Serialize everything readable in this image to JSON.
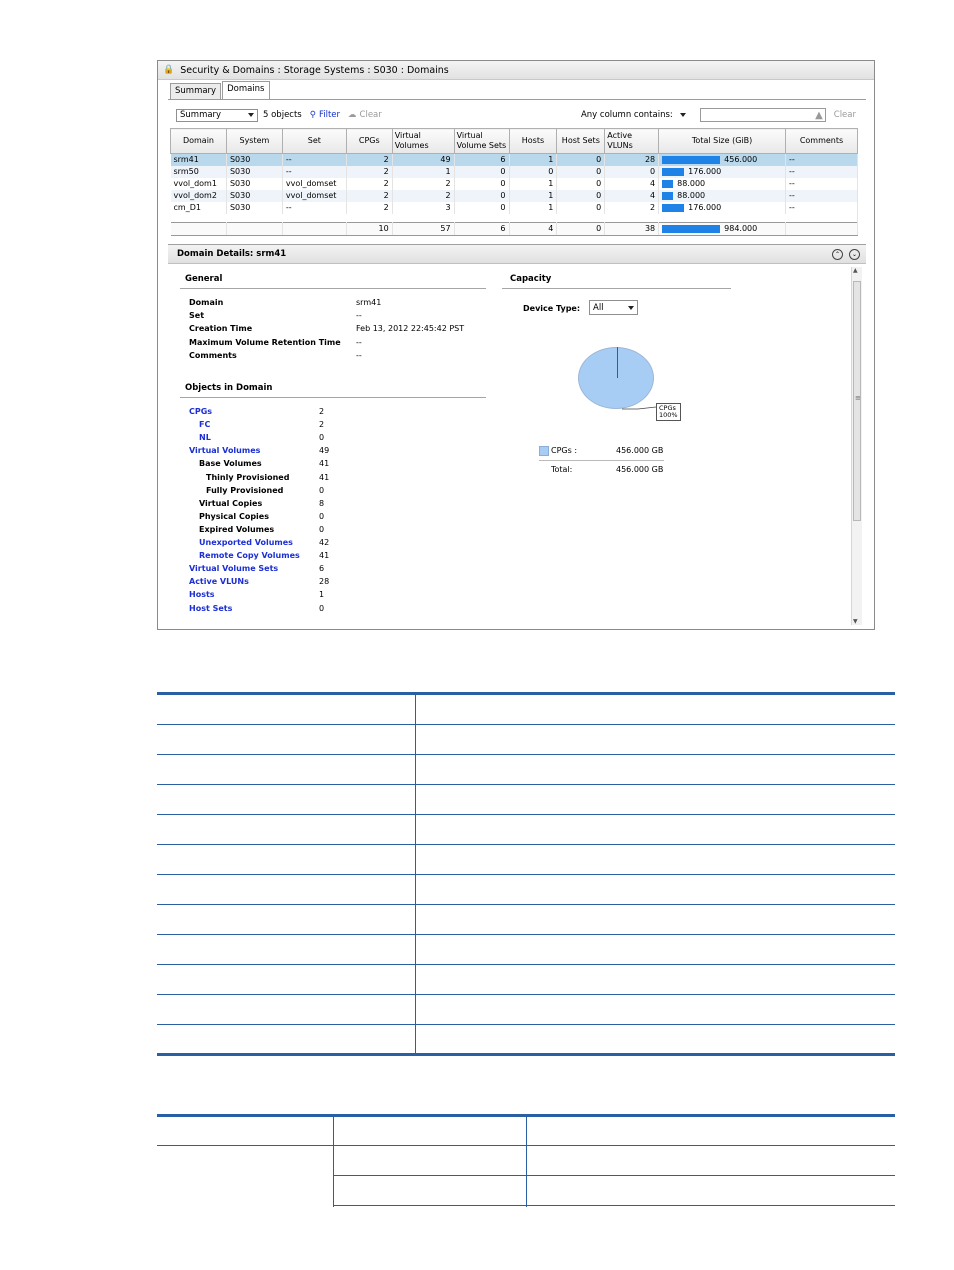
{
  "window": {
    "title": "Security & Domains : Storage Systems : S030 : Domains",
    "tabs": [
      "Summary",
      "Domains"
    ]
  },
  "toolbar": {
    "view_select": "Summary",
    "object_count": "5 objects",
    "filter_label": "Filter",
    "clear_label": "Clear",
    "search_label": "Any column contains:",
    "search_value": "",
    "search_clear": "Clear"
  },
  "grid": {
    "columns": [
      "Domain",
      "System",
      "Set",
      "CPGs",
      "Virtual Volumes",
      "Virtual Volume Sets",
      "Hosts",
      "Host Sets",
      "Active VLUNs",
      "Total Size (GiB)",
      "Comments"
    ],
    "rows": [
      {
        "domain": "srm41",
        "system": "S030",
        "set": "--",
        "cpgs": "2",
        "vv": "49",
        "vvsets": "6",
        "hosts": "1",
        "hostsets": "0",
        "vluns": "28",
        "size": "456.000",
        "size_frac": 1.0,
        "comments": "--"
      },
      {
        "domain": "srm50",
        "system": "S030",
        "set": "--",
        "cpgs": "2",
        "vv": "1",
        "vvsets": "0",
        "hosts": "0",
        "hostsets": "0",
        "vluns": "0",
        "size": "176.000",
        "size_frac": 0.386,
        "comments": "--"
      },
      {
        "domain": "vvol_dom1",
        "system": "S030",
        "set": "vvol_domset",
        "cpgs": "2",
        "vv": "2",
        "vvsets": "0",
        "hosts": "1",
        "hostsets": "0",
        "vluns": "4",
        "size": "88.000",
        "size_frac": 0.193,
        "comments": "--"
      },
      {
        "domain": "vvol_dom2",
        "system": "S030",
        "set": "vvol_domset",
        "cpgs": "2",
        "vv": "2",
        "vvsets": "0",
        "hosts": "1",
        "hostsets": "0",
        "vluns": "4",
        "size": "88.000",
        "size_frac": 0.193,
        "comments": "--"
      },
      {
        "domain": "cm_D1",
        "system": "S030",
        "set": "--",
        "cpgs": "2",
        "vv": "3",
        "vvsets": "0",
        "hosts": "1",
        "hostsets": "0",
        "vluns": "2",
        "size": "176.000",
        "size_frac": 0.386,
        "comments": "--"
      }
    ],
    "totals": {
      "cpgs": "10",
      "vv": "57",
      "vvsets": "6",
      "hosts": "4",
      "hostsets": "0",
      "vluns": "38",
      "size": "984.000",
      "size_frac": 1.0
    }
  },
  "details": {
    "title": "Domain Details: srm41",
    "general_title": "General",
    "general": [
      {
        "label": "Domain",
        "value": "srm41"
      },
      {
        "label": "Set",
        "value": "--"
      },
      {
        "label": "Creation Time",
        "value": "Feb 13, 2012 22:45:42 PST"
      },
      {
        "label": "Maximum Volume Retention Time",
        "value": "--"
      },
      {
        "label": "Comments",
        "value": "--"
      }
    ],
    "objects_title": "Objects in Domain",
    "objects": [
      {
        "label": "CPGs",
        "value": "2"
      },
      {
        "label": "FC",
        "value": "2"
      },
      {
        "label": "NL",
        "value": "0"
      },
      {
        "label": "Virtual Volumes",
        "value": "49"
      },
      {
        "label": "Base Volumes",
        "value": "41"
      },
      {
        "label": "Thinly Provisioned",
        "value": "41"
      },
      {
        "label": "Fully Provisioned",
        "value": "0"
      },
      {
        "label": "Virtual Copies",
        "value": "8"
      },
      {
        "label": "Physical Copies",
        "value": "0"
      },
      {
        "label": "Expired Volumes",
        "value": "0"
      },
      {
        "label": "Unexported Volumes",
        "value": "42"
      },
      {
        "label": "Remote Copy Volumes",
        "value": "41"
      },
      {
        "label": "Virtual Volume Sets",
        "value": "6"
      },
      {
        "label": "Active VLUNs",
        "value": "28"
      },
      {
        "label": "Hosts",
        "value": "1"
      },
      {
        "label": "Host Sets",
        "value": "0"
      }
    ],
    "capacity_title": "Capacity",
    "device_type_label": "Device Type:",
    "device_type_value": "All",
    "pie_label_line1": "CPGs",
    "pie_label_line2": "100%",
    "legend_label": "CPGs :",
    "legend_value": "456.000 GB",
    "total_label": "Total:",
    "total_value": "456.000 GB"
  },
  "colors": {
    "selected_row": "#b9d8ec",
    "bar": "#1e82e6",
    "pie": "#a8cdf4",
    "link": "#1b2fd3",
    "doc_rule": "#2a5fa3"
  }
}
